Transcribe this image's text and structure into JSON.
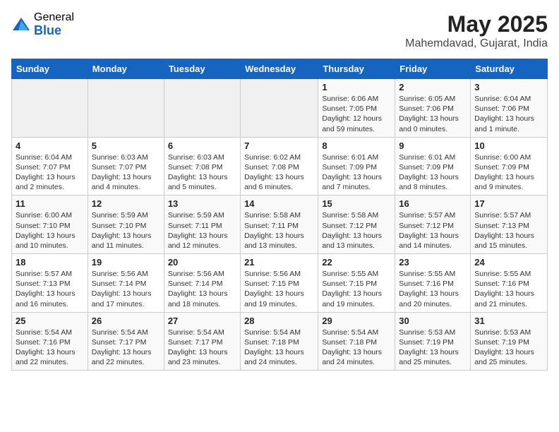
{
  "logo": {
    "general": "General",
    "blue": "Blue"
  },
  "title": {
    "month_year": "May 2025",
    "location": "Mahemdavad, Gujarat, India"
  },
  "weekdays": [
    "Sunday",
    "Monday",
    "Tuesday",
    "Wednesday",
    "Thursday",
    "Friday",
    "Saturday"
  ],
  "weeks": [
    [
      {
        "day": "",
        "info": ""
      },
      {
        "day": "",
        "info": ""
      },
      {
        "day": "",
        "info": ""
      },
      {
        "day": "",
        "info": ""
      },
      {
        "day": "1",
        "info": "Sunrise: 6:06 AM\nSunset: 7:05 PM\nDaylight: 12 hours and 59 minutes."
      },
      {
        "day": "2",
        "info": "Sunrise: 6:05 AM\nSunset: 7:06 PM\nDaylight: 13 hours and 0 minutes."
      },
      {
        "day": "3",
        "info": "Sunrise: 6:04 AM\nSunset: 7:06 PM\nDaylight: 13 hours and 1 minute."
      }
    ],
    [
      {
        "day": "4",
        "info": "Sunrise: 6:04 AM\nSunset: 7:07 PM\nDaylight: 13 hours and 2 minutes."
      },
      {
        "day": "5",
        "info": "Sunrise: 6:03 AM\nSunset: 7:07 PM\nDaylight: 13 hours and 4 minutes."
      },
      {
        "day": "6",
        "info": "Sunrise: 6:03 AM\nSunset: 7:08 PM\nDaylight: 13 hours and 5 minutes."
      },
      {
        "day": "7",
        "info": "Sunrise: 6:02 AM\nSunset: 7:08 PM\nDaylight: 13 hours and 6 minutes."
      },
      {
        "day": "8",
        "info": "Sunrise: 6:01 AM\nSunset: 7:09 PM\nDaylight: 13 hours and 7 minutes."
      },
      {
        "day": "9",
        "info": "Sunrise: 6:01 AM\nSunset: 7:09 PM\nDaylight: 13 hours and 8 minutes."
      },
      {
        "day": "10",
        "info": "Sunrise: 6:00 AM\nSunset: 7:09 PM\nDaylight: 13 hours and 9 minutes."
      }
    ],
    [
      {
        "day": "11",
        "info": "Sunrise: 6:00 AM\nSunset: 7:10 PM\nDaylight: 13 hours and 10 minutes."
      },
      {
        "day": "12",
        "info": "Sunrise: 5:59 AM\nSunset: 7:10 PM\nDaylight: 13 hours and 11 minutes."
      },
      {
        "day": "13",
        "info": "Sunrise: 5:59 AM\nSunset: 7:11 PM\nDaylight: 13 hours and 12 minutes."
      },
      {
        "day": "14",
        "info": "Sunrise: 5:58 AM\nSunset: 7:11 PM\nDaylight: 13 hours and 13 minutes."
      },
      {
        "day": "15",
        "info": "Sunrise: 5:58 AM\nSunset: 7:12 PM\nDaylight: 13 hours and 13 minutes."
      },
      {
        "day": "16",
        "info": "Sunrise: 5:57 AM\nSunset: 7:12 PM\nDaylight: 13 hours and 14 minutes."
      },
      {
        "day": "17",
        "info": "Sunrise: 5:57 AM\nSunset: 7:13 PM\nDaylight: 13 hours and 15 minutes."
      }
    ],
    [
      {
        "day": "18",
        "info": "Sunrise: 5:57 AM\nSunset: 7:13 PM\nDaylight: 13 hours and 16 minutes."
      },
      {
        "day": "19",
        "info": "Sunrise: 5:56 AM\nSunset: 7:14 PM\nDaylight: 13 hours and 17 minutes."
      },
      {
        "day": "20",
        "info": "Sunrise: 5:56 AM\nSunset: 7:14 PM\nDaylight: 13 hours and 18 minutes."
      },
      {
        "day": "21",
        "info": "Sunrise: 5:56 AM\nSunset: 7:15 PM\nDaylight: 13 hours and 19 minutes."
      },
      {
        "day": "22",
        "info": "Sunrise: 5:55 AM\nSunset: 7:15 PM\nDaylight: 13 hours and 19 minutes."
      },
      {
        "day": "23",
        "info": "Sunrise: 5:55 AM\nSunset: 7:16 PM\nDaylight: 13 hours and 20 minutes."
      },
      {
        "day": "24",
        "info": "Sunrise: 5:55 AM\nSunset: 7:16 PM\nDaylight: 13 hours and 21 minutes."
      }
    ],
    [
      {
        "day": "25",
        "info": "Sunrise: 5:54 AM\nSunset: 7:16 PM\nDaylight: 13 hours and 22 minutes."
      },
      {
        "day": "26",
        "info": "Sunrise: 5:54 AM\nSunset: 7:17 PM\nDaylight: 13 hours and 22 minutes."
      },
      {
        "day": "27",
        "info": "Sunrise: 5:54 AM\nSunset: 7:17 PM\nDaylight: 13 hours and 23 minutes."
      },
      {
        "day": "28",
        "info": "Sunrise: 5:54 AM\nSunset: 7:18 PM\nDaylight: 13 hours and 24 minutes."
      },
      {
        "day": "29",
        "info": "Sunrise: 5:54 AM\nSunset: 7:18 PM\nDaylight: 13 hours and 24 minutes."
      },
      {
        "day": "30",
        "info": "Sunrise: 5:53 AM\nSunset: 7:19 PM\nDaylight: 13 hours and 25 minutes."
      },
      {
        "day": "31",
        "info": "Sunrise: 5:53 AM\nSunset: 7:19 PM\nDaylight: 13 hours and 25 minutes."
      }
    ]
  ]
}
